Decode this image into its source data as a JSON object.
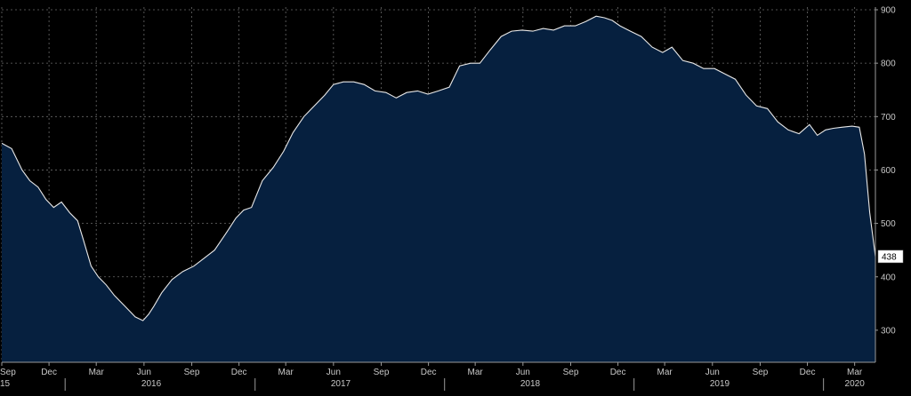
{
  "chart_data": {
    "type": "area",
    "title": "",
    "xlabel": "",
    "ylabel": "",
    "ylim": [
      240,
      905
    ],
    "y_ticks": [
      300,
      400,
      500,
      600,
      700,
      800,
      900
    ],
    "x_range": [
      "2015-09-01",
      "2020-04-10"
    ],
    "month_ticks": [
      {
        "date": "2015-09-01",
        "label": "Sep"
      },
      {
        "date": "2015-12-01",
        "label": "Dec"
      },
      {
        "date": "2016-03-01",
        "label": "Mar"
      },
      {
        "date": "2016-06-01",
        "label": "Jun"
      },
      {
        "date": "2016-09-01",
        "label": "Sep"
      },
      {
        "date": "2016-12-01",
        "label": "Dec"
      },
      {
        "date": "2017-03-01",
        "label": "Mar"
      },
      {
        "date": "2017-06-01",
        "label": "Jun"
      },
      {
        "date": "2017-09-01",
        "label": "Sep"
      },
      {
        "date": "2017-12-01",
        "label": "Dec"
      },
      {
        "date": "2018-03-01",
        "label": "Mar"
      },
      {
        "date": "2018-06-01",
        "label": "Jun"
      },
      {
        "date": "2018-09-01",
        "label": "Sep"
      },
      {
        "date": "2018-12-01",
        "label": "Dec"
      },
      {
        "date": "2019-03-01",
        "label": "Mar"
      },
      {
        "date": "2019-06-01",
        "label": "Jun"
      },
      {
        "date": "2019-09-01",
        "label": "Sep"
      },
      {
        "date": "2019-12-01",
        "label": "Dec"
      },
      {
        "date": "2020-03-01",
        "label": "Mar"
      }
    ],
    "year_labels": [
      {
        "date": "2015-09-01",
        "label": "15"
      },
      {
        "date": "2016-06-15",
        "label": "2016"
      },
      {
        "date": "2017-06-15",
        "label": "2017"
      },
      {
        "date": "2018-06-15",
        "label": "2018"
      },
      {
        "date": "2019-06-15",
        "label": "2019"
      },
      {
        "date": "2020-03-01",
        "label": "2020"
      }
    ],
    "series": [
      {
        "x": [
          "2015-09-01",
          "2015-09-20",
          "2015-10-10",
          "2015-10-25",
          "2015-11-10",
          "2015-11-25",
          "2015-12-10",
          "2015-12-25",
          "2016-01-10",
          "2016-01-25",
          "2016-02-05",
          "2016-02-20",
          "2016-03-05",
          "2016-03-20",
          "2016-04-05",
          "2016-04-25",
          "2016-05-15",
          "2016-05-30",
          "2016-06-10",
          "2016-06-20",
          "2016-07-05",
          "2016-07-25",
          "2016-08-15",
          "2016-09-05",
          "2016-09-25",
          "2016-10-15",
          "2016-11-05",
          "2016-11-25",
          "2016-12-10",
          "2016-12-25",
          "2017-01-15",
          "2017-02-05",
          "2017-02-25",
          "2017-03-15",
          "2017-04-05",
          "2017-04-25",
          "2017-05-15",
          "2017-06-01",
          "2017-06-20",
          "2017-07-10",
          "2017-07-30",
          "2017-08-20",
          "2017-09-10",
          "2017-09-30",
          "2017-10-20",
          "2017-11-10",
          "2017-11-30",
          "2017-12-20",
          "2018-01-10",
          "2018-01-30",
          "2018-02-20",
          "2018-03-10",
          "2018-03-30",
          "2018-04-20",
          "2018-05-10",
          "2018-05-30",
          "2018-06-20",
          "2018-07-10",
          "2018-07-30",
          "2018-08-20",
          "2018-09-10",
          "2018-09-30",
          "2018-10-20",
          "2018-11-05",
          "2018-11-20",
          "2018-12-05",
          "2018-12-25",
          "2019-01-15",
          "2019-02-05",
          "2019-02-25",
          "2019-03-15",
          "2019-04-05",
          "2019-04-25",
          "2019-05-15",
          "2019-06-05",
          "2019-06-25",
          "2019-07-15",
          "2019-08-05",
          "2019-08-25",
          "2019-09-15",
          "2019-10-05",
          "2019-10-25",
          "2019-11-15",
          "2019-12-05",
          "2019-12-20",
          "2020-01-05",
          "2020-01-20",
          "2020-02-05",
          "2020-02-25",
          "2020-03-10",
          "2020-03-20",
          "2020-03-30",
          "2020-04-10"
        ],
        "y": [
          650,
          640,
          600,
          580,
          568,
          545,
          530,
          540,
          520,
          505,
          470,
          420,
          400,
          385,
          365,
          345,
          325,
          318,
          330,
          345,
          370,
          395,
          410,
          420,
          435,
          450,
          480,
          510,
          525,
          530,
          580,
          605,
          635,
          670,
          700,
          720,
          740,
          760,
          765,
          765,
          760,
          748,
          745,
          735,
          745,
          748,
          742,
          748,
          755,
          795,
          800,
          800,
          825,
          850,
          860,
          862,
          860,
          865,
          862,
          870,
          870,
          878,
          888,
          885,
          880,
          870,
          860,
          850,
          830,
          820,
          830,
          805,
          800,
          790,
          790,
          780,
          770,
          740,
          720,
          715,
          690,
          675,
          668,
          685,
          665,
          675,
          678,
          680,
          682,
          680,
          630,
          520,
          438
        ]
      }
    ],
    "last_value_label": "438",
    "colors": {
      "background": "#000000",
      "area_fill": "#06203f",
      "line": "#e8e8e8",
      "grid": "#6a6a6a",
      "label_box": "#ffffff"
    },
    "grid": true,
    "y_axis_position": "right"
  }
}
